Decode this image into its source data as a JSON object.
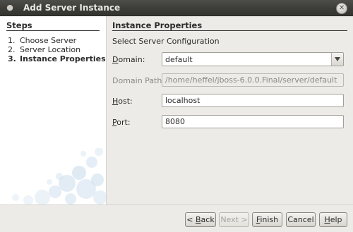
{
  "window": {
    "title": "Add Server Instance",
    "menu_icon": "dot-menu-icon",
    "close_icon": "close-icon"
  },
  "steps": {
    "title": "Steps",
    "items": [
      {
        "num": "1.",
        "label": "Choose Server"
      },
      {
        "num": "2.",
        "label": "Server Location"
      },
      {
        "num": "3.",
        "label": "Instance Properties",
        "current": true
      }
    ]
  },
  "content": {
    "title": "Instance Properties",
    "subtitle": "Select Server Configuration",
    "domain": {
      "label_u": "D",
      "label_rest": "omain:",
      "value": "default"
    },
    "domain_path": {
      "label": "Domain Path:",
      "value": "/home/heffel/jboss-6.0.0.Final/server/default"
    },
    "host": {
      "label_u": "H",
      "label_rest": "ost:",
      "value": "localhost"
    },
    "port": {
      "label_u": "P",
      "label_rest": "ort:",
      "value": "8080"
    }
  },
  "buttons": {
    "back": {
      "prefix": "< ",
      "u": "B",
      "rest": "ack"
    },
    "next": "Next >",
    "finish": {
      "u": "F",
      "rest": "inish"
    },
    "cancel": "Cancel",
    "help": {
      "u": "H",
      "rest": "elp"
    }
  },
  "colors": {
    "titlebar": "#3b3b38",
    "panel": "#edebe7",
    "bubbles": "#c6d9ea"
  }
}
